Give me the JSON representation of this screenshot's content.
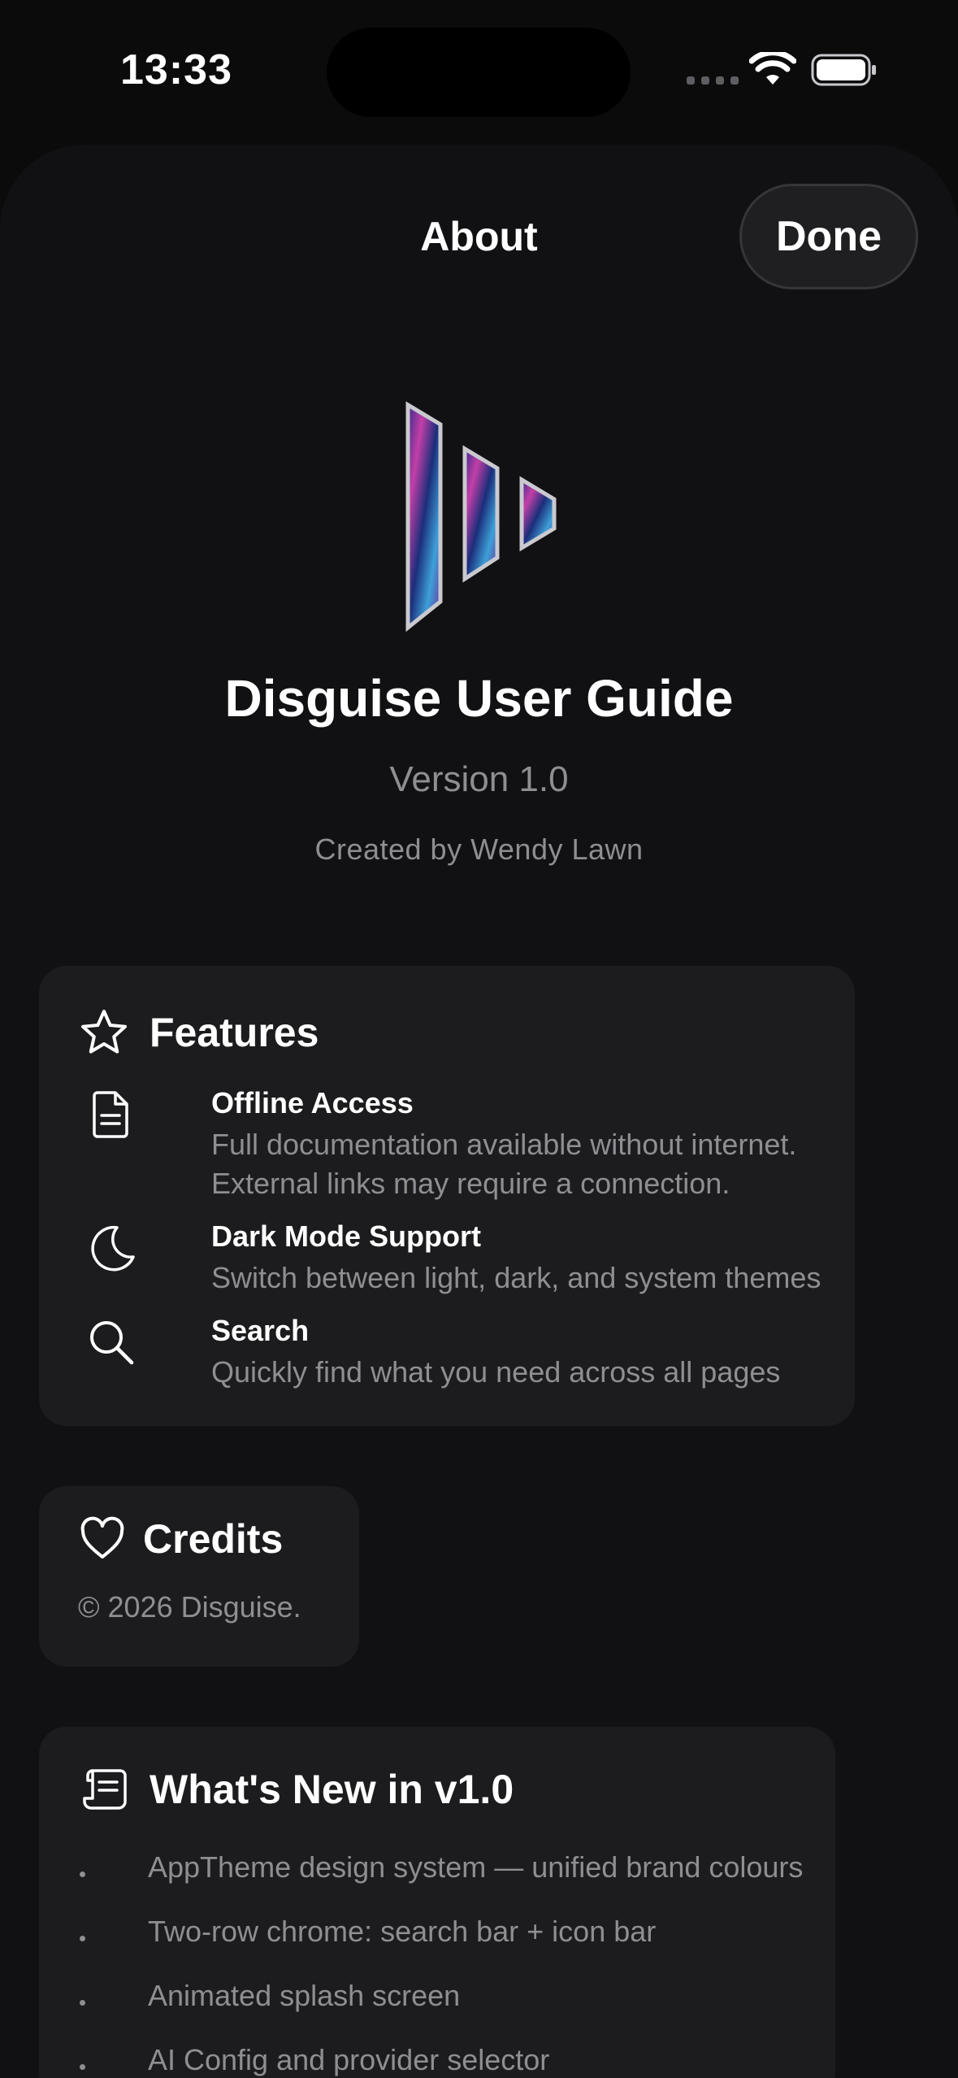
{
  "status_bar": {
    "time": "13:33"
  },
  "nav": {
    "title": "About",
    "done_label": "Done"
  },
  "app": {
    "title": "Disguise User Guide",
    "version": "Version 1.0",
    "author": "Created by Wendy Lawn",
    "logo_icon": "disguise-logo-icon"
  },
  "features": {
    "title": "Features",
    "icon": "star-icon",
    "items": [
      {
        "icon": "document-icon",
        "title": "Offline Access",
        "desc": "Full documentation available without internet. External links may require a connection."
      },
      {
        "icon": "moon-icon",
        "title": "Dark Mode Support",
        "desc": "Switch between light, dark, and system themes"
      },
      {
        "icon": "search-icon",
        "title": "Search",
        "desc": "Quickly find what you need across all pages"
      }
    ]
  },
  "credits": {
    "title": "Credits",
    "icon": "heart-icon",
    "text": "© 2026 Disguise."
  },
  "whats_new": {
    "title": "What's New in v1.0",
    "icon": "scroll-icon",
    "items": [
      "AppTheme design system — unified brand colours",
      "Two-row chrome: search bar + icon bar",
      "Animated splash screen",
      "AI Config and provider selector"
    ]
  },
  "colors": {
    "background": "#0b0b0c",
    "sheet": "#111113",
    "card": "#1c1c1e",
    "secondary_text": "#8e8e93",
    "primary_text": "#ffffff"
  }
}
